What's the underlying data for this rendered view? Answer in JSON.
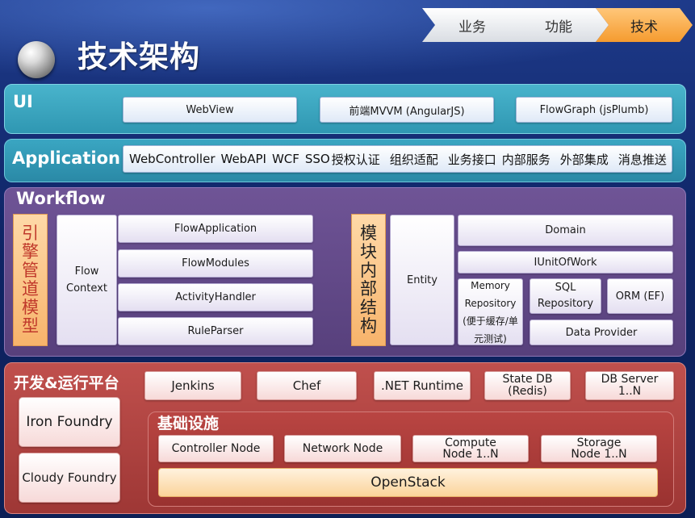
{
  "header": {
    "title": "技术架构",
    "nav": [
      {
        "label": "业务",
        "active": false
      },
      {
        "label": "功能",
        "active": false
      },
      {
        "label": "技术",
        "active": true
      }
    ]
  },
  "layers": {
    "ui": {
      "label": "UI",
      "items": [
        "WebView",
        "前端MVVM (AngularJS)",
        "FlowGraph (jsPlumb)"
      ]
    },
    "application": {
      "label": "Application",
      "items": [
        "WebController",
        "WebAPI",
        "WCF",
        "SSO",
        "授权认证",
        "组织适配",
        "业务接口",
        "内部服务",
        "外部集成",
        "消息推送"
      ]
    },
    "workflow": {
      "label": "Workflow",
      "engine_label_chars": [
        "引",
        "擎",
        "管",
        "道",
        "模",
        "型"
      ],
      "engine_label_colors": [
        "#c0392b",
        "#c0392b",
        "#c0392b",
        "#c0392b",
        "#c0392b",
        "#c0392b"
      ],
      "flow_context": "Flow Context",
      "engine_items": [
        "FlowApplication",
        "FlowModules",
        "ActivityHandler",
        "RuleParser"
      ],
      "module_label_chars": [
        "模",
        "块",
        "内",
        "部",
        "结",
        "构"
      ],
      "entity": "Entity",
      "domain": "Domain",
      "iunitofwork": "IUnitOfWork",
      "memory_repo": "Memory Repository (便于缓存/单元测试)",
      "sql_repo": "SQL Repository",
      "orm": "ORM (EF)",
      "data_provider": "Data Provider"
    },
    "devops": {
      "label": "开发&运行平台",
      "tools": [
        "Jenkins",
        "Chef",
        ".NET Runtime",
        "State DB (Redis)",
        "DB Server 1..N"
      ],
      "foundries": [
        "Iron Foundry",
        "Cloudy Foundry"
      ],
      "infra": {
        "label": "基础设施",
        "nodes": [
          "Controller Node",
          "Network Node",
          "Compute Node 1..N",
          "Storage Node 1..N"
        ],
        "platform": "OpenStack"
      }
    }
  },
  "colors": {
    "background": "#12235a",
    "ui_layer": "#3aa7c0",
    "workflow_layer": "#644a89",
    "devops_layer": "#b04441",
    "nav_active": "#f59b2f",
    "engine_label_text": "#c0392b",
    "module_label_text": "#222222"
  }
}
